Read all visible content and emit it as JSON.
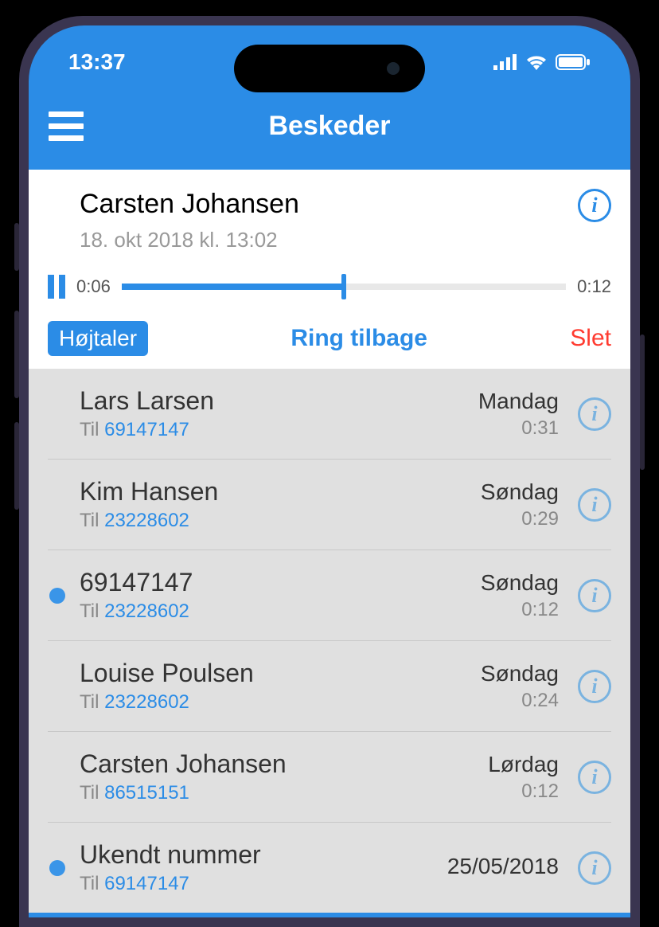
{
  "status": {
    "time": "13:37"
  },
  "nav": {
    "title": "Beskeder"
  },
  "player": {
    "name": "Carsten Johansen",
    "date": "18. okt 2018 kl. 13:02",
    "elapsed": "0:06",
    "total": "0:12",
    "progress_pct": 50,
    "actions": {
      "speaker": "Højtaler",
      "callback": "Ring tilbage",
      "delete": "Slet"
    }
  },
  "to_prefix": "Til ",
  "messages": [
    {
      "name": "Lars Larsen",
      "to": "69147147",
      "day": "Mandag",
      "duration": "0:31",
      "unread": false
    },
    {
      "name": "Kim Hansen",
      "to": "23228602",
      "day": "Søndag",
      "duration": "0:29",
      "unread": false
    },
    {
      "name": "69147147",
      "to": "23228602",
      "day": "Søndag",
      "duration": "0:12",
      "unread": true
    },
    {
      "name": "Louise Poulsen",
      "to": "23228602",
      "day": "Søndag",
      "duration": "0:24",
      "unread": false
    },
    {
      "name": "Carsten Johansen",
      "to": "86515151",
      "day": "Lørdag",
      "duration": "0:12",
      "unread": false
    },
    {
      "name": "Ukendt nummer",
      "to": "69147147",
      "day": "25/05/2018",
      "duration": "",
      "unread": true
    }
  ]
}
